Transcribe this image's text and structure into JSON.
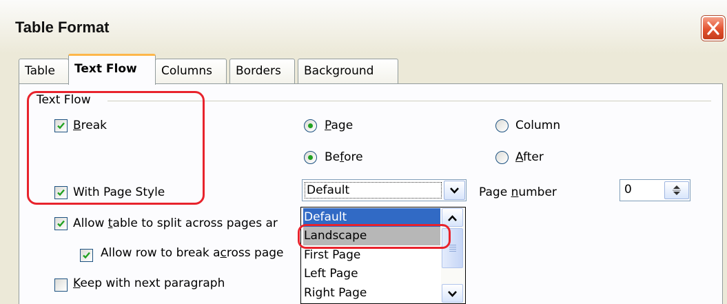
{
  "window": {
    "title": "Table Format"
  },
  "tabs": [
    {
      "label": "Table",
      "active": false
    },
    {
      "label": "Text Flow",
      "active": true
    },
    {
      "label": "Columns",
      "active": false
    },
    {
      "label": "Borders",
      "active": false
    },
    {
      "label": "Background",
      "active": false
    }
  ],
  "text_flow": {
    "group_label": "Text Flow",
    "break": {
      "label_rest": "reak",
      "mnemonic": "B",
      "checked": true
    },
    "page_radio": {
      "label_rest": "age",
      "mnemonic": "P",
      "selected": true
    },
    "column_radio": {
      "label": "Column",
      "selected": false
    },
    "before_radio": {
      "label_pre": "Be",
      "mnemonic": "f",
      "label_post": "ore",
      "selected": true
    },
    "after_radio": {
      "label_rest": "fter",
      "mnemonic": "A",
      "selected": false
    },
    "with_page_style": {
      "label": "With Page Style",
      "checked": true
    },
    "page_style_combo": {
      "value": "Default"
    },
    "page_number": {
      "label_pre": "Page ",
      "mnemonic": "n",
      "label_post": "umber",
      "value": "0"
    },
    "allow_split": {
      "label_pre": "Allow ",
      "mnemonic": "t",
      "label_post": "able to split across pages ar",
      "checked": true
    },
    "allow_row_break": {
      "label_pre": "Allow row to break a",
      "mnemonic": "c",
      "label_post": "ross page",
      "checked": true
    },
    "keep_with_next": {
      "label_rest": "eep with next paragraph",
      "mnemonic": "K",
      "checked": false
    }
  },
  "page_style_dropdown": {
    "options": [
      "Default",
      "Landscape",
      "First Page",
      "Left Page",
      "Right Page"
    ],
    "selected_index": 0,
    "hover_index": 1
  },
  "colors": {
    "annotation": "#e8232c",
    "selection": "#316ac5",
    "tab_active_accent": "#fdb74a",
    "check_green": "#21a121"
  },
  "icons": [
    "close-icon",
    "checkmark-icon",
    "chevron-down-icon",
    "chevron-up-icon",
    "spin-arrows-icon"
  ]
}
